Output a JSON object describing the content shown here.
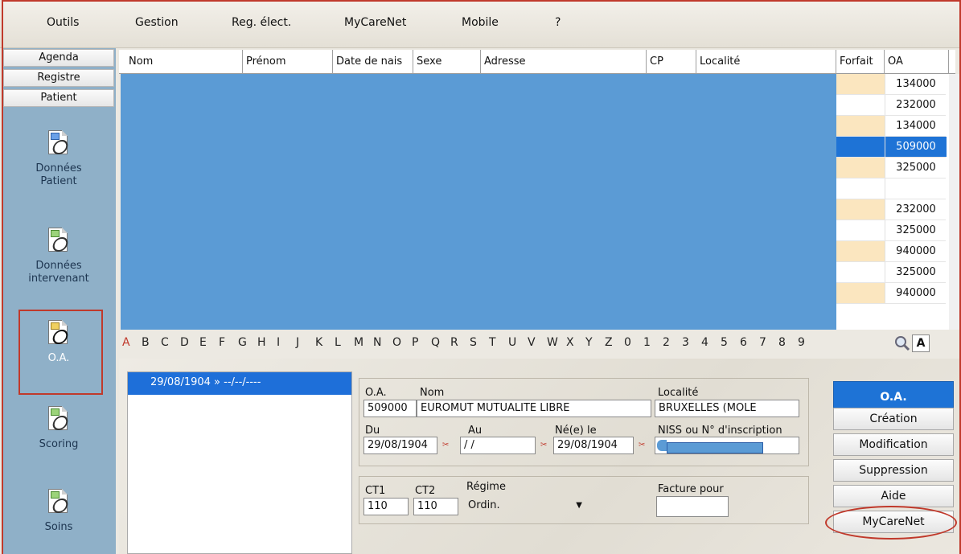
{
  "menu": {
    "items": [
      "Outils",
      "Gestion",
      "Reg. élect.",
      "MyCareNet",
      "Mobile",
      "?"
    ]
  },
  "nav": {
    "tabs": [
      "Agenda",
      "Registre",
      "Patient"
    ],
    "buttons": [
      {
        "label1": "Données",
        "label2": "Patient"
      },
      {
        "label1": "Données",
        "label2": "intervenant"
      },
      {
        "label1": "O.A.",
        "label2": ""
      },
      {
        "label1": "Scoring",
        "label2": ""
      },
      {
        "label1": "Soins",
        "label2": ""
      }
    ]
  },
  "grid": {
    "columns": [
      "Nom",
      "Prénom",
      "Date de nais",
      "Sexe",
      "Adresse",
      "CP",
      "Localité",
      "Forfait",
      "OA"
    ],
    "oa_values": [
      "134000",
      "232000",
      "134000",
      "509000",
      "325000",
      "",
      "232000",
      "325000",
      "940000",
      "325000",
      "940000"
    ],
    "selected_row": 3
  },
  "alphabet": [
    "A",
    "B",
    "C",
    "D",
    "E",
    "F",
    "G",
    "H",
    "I",
    "J",
    "K",
    "L",
    "M",
    "N",
    "O",
    "P",
    "Q",
    "R",
    "S",
    "T",
    "U",
    "V",
    "W",
    "X",
    "Y",
    "Z",
    "0",
    "1",
    "2",
    "3",
    "4",
    "5",
    "6",
    "7",
    "8",
    "9"
  ],
  "alpha_button": "A",
  "history": {
    "entry": "29/08/1904 » --/--/----"
  },
  "form": {
    "oa_label": "O.A.",
    "oa_value": "509000",
    "nom_label": "Nom",
    "nom_value": "EUROMUT  MUTUALITE LIBRE",
    "localite_label": "Localité",
    "localite_value": "BRUXELLES (MOLE",
    "du_label": "Du",
    "du_value": "29/08/1904",
    "au_label": "Au",
    "au_value": " /  /",
    "ne_label": "Né(e) le",
    "ne_value": "29/08/1904",
    "niss_label": "NISS ou N° d'inscription",
    "ct1_label": "CT1",
    "ct1_value": "110",
    "ct2_label": "CT2",
    "ct2_value": "110",
    "regime_label": "Régime",
    "regime_value": "Ordin.",
    "facture_label": "Facture pour",
    "facture_value": ""
  },
  "actions": {
    "oa": "O.A.",
    "creation": "Création",
    "modification": "Modification",
    "suppression": "Suppression",
    "aide": "Aide",
    "mycarenet": "MyCareNet"
  },
  "colors": {
    "selection": "#1e73d6",
    "grid_fill": "#5b9bd5",
    "forfait": "#fbe6bf",
    "highlight": "#c0392b"
  }
}
